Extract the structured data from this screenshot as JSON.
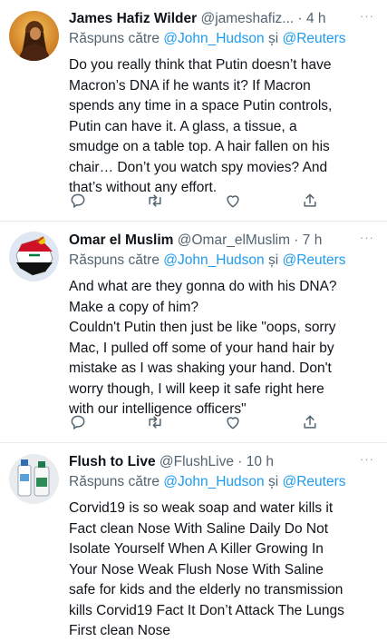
{
  "tweets": [
    {
      "name": "James Hafiz Wilder",
      "handle": "@jameshafiz...",
      "sep": " · ",
      "time": "4 h",
      "reply_prefix": "Răspuns către ",
      "reply_mention_1": "@John_Hudson",
      "reply_join": " și ",
      "reply_mention_2": "@Reuters",
      "text": "Do you really think that Putin doesn’t have\nMacron’s DNA if he wants it? If Macron\nspends any time in a space Putin controls,\nPutin can have it. A glass, a tissue, a\nsmudge on a table top. A hair fallen on his\nchair… Don’t you watch spy movies? And\nthat’s without any effort.",
      "more": "···",
      "avatar": "person-portrait-avatar"
    },
    {
      "name": "Omar el Muslim",
      "handle": "@Omar_elMuslim",
      "sep": " · ",
      "time": "7 h",
      "reply_prefix": "Răspuns către ",
      "reply_mention_1": "@John_Hudson",
      "reply_join": " și ",
      "reply_mention_2": "@Reuters",
      "text": "And what are they gonna do with his DNA?\nMake a copy of him?\nCouldn't Putin then just be like \"oops, sorry\nMac, I pulled off some of your hand hair by\nmistake as I was shaking your hand. Don't\nworry though, I will keep it safe right here\nwith our intelligence officers\"",
      "more": "···",
      "avatar": "iraq-map-flag-avatar"
    },
    {
      "name": "Flush to Live",
      "handle": "@FlushLive",
      "sep": " · ",
      "time": "10 h",
      "reply_prefix": "Răspuns către ",
      "reply_mention_1": "@John_Hudson",
      "reply_join": " și ",
      "reply_mention_2": "@Reuters",
      "text": "Corvid19 is so weak soap and water kills it\nFact clean Nose With Saline Daily Do Not\nIsolate Yourself When A Killer Growing In\nYour Nose Weak Flush Nose With Saline\nsafe for kids and the elderly no transmission\nkills Corvid19 Fact It Don’t Attack The Lungs\nFirst clean Nose",
      "more": "···",
      "avatar": "saline-bottles-avatar"
    }
  ],
  "action_icons": [
    "reply-icon",
    "retweet-icon",
    "like-icon",
    "share-icon"
  ],
  "colors": {
    "link": "#1d9bf0",
    "secondary": "#536471",
    "text": "#0f1419",
    "divider": "#e6ecf0"
  }
}
